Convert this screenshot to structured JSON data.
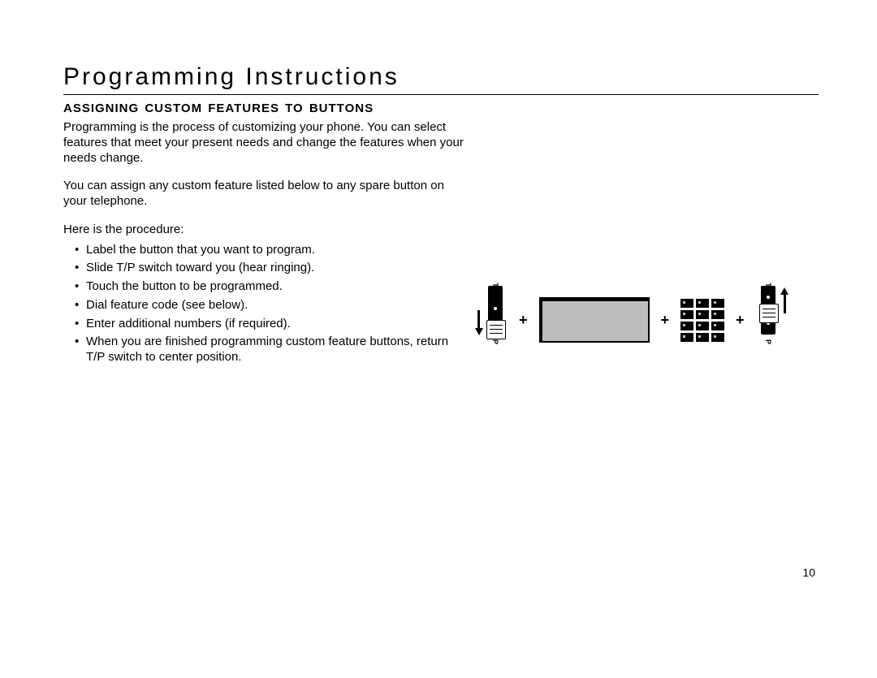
{
  "title": "Programming Instructions",
  "subhead": "ASSIGNING CUSTOM FEATURES TO BUTTONS",
  "para1": "Programming is the process of customizing your phone. You can select features that meet your present needs and change the features when your needs change.",
  "para2": "You can assign any custom feature listed below to any spare button on your telephone.",
  "para3": "Here is the procedure:",
  "bullets": [
    "Label the button that you want to program.",
    "Slide T/P switch toward you (hear ringing).",
    "Touch the button to be programmed.",
    "Dial feature code (see below).",
    "Enter additional numbers (if required).",
    "When you are finished programming custom feature buttons, return T/P switch to center position."
  ],
  "plus": "+",
  "tp_label_t": "T",
  "tp_label_p": "P",
  "page_number": "10"
}
